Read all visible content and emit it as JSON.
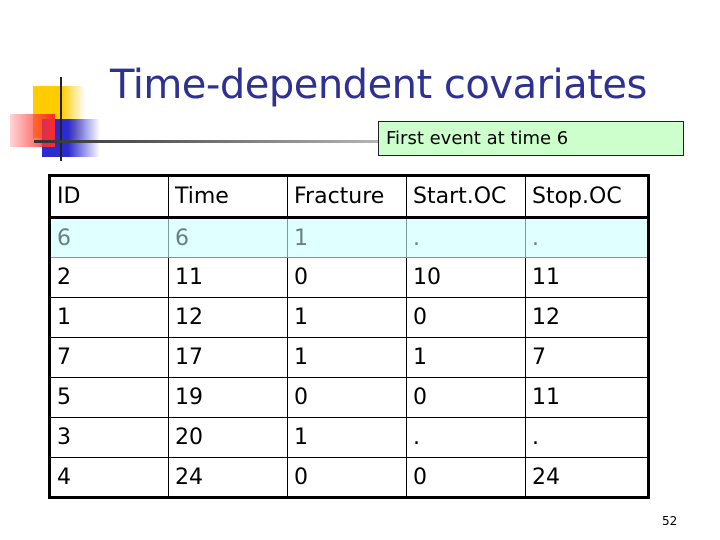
{
  "slide": {
    "title": "Time-dependent covariates",
    "callout": "First event at time 6",
    "page_number": "52"
  },
  "table": {
    "headers": [
      "ID",
      "Time",
      "Fracture",
      "Start.OC",
      "Stop.OC"
    ],
    "rows": [
      [
        "6",
        "6",
        "1",
        ".",
        "."
      ],
      [
        "2",
        "11",
        "0",
        "10",
        "11"
      ],
      [
        "1",
        "12",
        "1",
        "0",
        "12"
      ],
      [
        "7",
        "17",
        "1",
        "1",
        "7"
      ],
      [
        "5",
        "19",
        "0",
        "0",
        "11"
      ],
      [
        "3",
        "20",
        "1",
        ".",
        "."
      ],
      [
        "4",
        "24",
        "0",
        "0",
        "24"
      ]
    ],
    "highlighted_row": 0
  },
  "colors": {
    "title": "#2e3192",
    "callout_bg": "#ccffcc",
    "highlight_row_bg": "#e0ffff"
  },
  "icons": [
    "slide-logo-icon"
  ]
}
